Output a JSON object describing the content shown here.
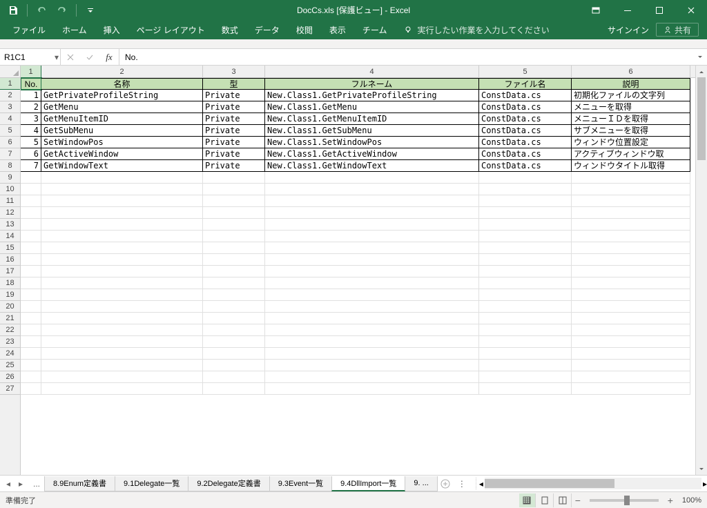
{
  "titlebar": {
    "filename": "DocCs.xls",
    "mode": "[保護ビュー]",
    "app": "Excel"
  },
  "ribbon": {
    "tabs": [
      "ファイル",
      "ホーム",
      "挿入",
      "ページ レイアウト",
      "数式",
      "データ",
      "校閲",
      "表示",
      "チーム"
    ],
    "tell_me": "実行したい作業を入力してください",
    "signin": "サインイン",
    "share": "共有"
  },
  "formula": {
    "namebox": "R1C1",
    "value": "No."
  },
  "columns": {
    "headers": [
      "1",
      "2",
      "3",
      "4",
      "5",
      "6"
    ],
    "widths": [
      30,
      234,
      90,
      310,
      134,
      172
    ]
  },
  "rows": {
    "count": 27
  },
  "table": {
    "headers": [
      "No.",
      "名称",
      "型",
      "フルネーム",
      "ファイル名",
      "説明"
    ],
    "data": [
      {
        "no": "1",
        "name": "GetPrivateProfileString",
        "type": "Private",
        "full": "New.Class1.GetPrivateProfileString",
        "file": "ConstData.cs",
        "desc": "初期化ファイルの文字列"
      },
      {
        "no": "2",
        "name": "GetMenu",
        "type": "Private",
        "full": "New.Class1.GetMenu",
        "file": "ConstData.cs",
        "desc": "メニューを取得"
      },
      {
        "no": "3",
        "name": "GetMenuItemID",
        "type": "Private",
        "full": "New.Class1.GetMenuItemID",
        "file": "ConstData.cs",
        "desc": "メニューＩＤを取得"
      },
      {
        "no": "4",
        "name": "GetSubMenu",
        "type": "Private",
        "full": "New.Class1.GetSubMenu",
        "file": "ConstData.cs",
        "desc": "サブメニューを取得"
      },
      {
        "no": "5",
        "name": "SetWindowPos",
        "type": "Private",
        "full": "New.Class1.SetWindowPos",
        "file": "ConstData.cs",
        "desc": "ウィンドウ位置設定"
      },
      {
        "no": "6",
        "name": "GetActiveWindow",
        "type": "Private",
        "full": "New.Class1.GetActiveWindow",
        "file": "ConstData.cs",
        "desc": "アクティブウィンドウ取"
      },
      {
        "no": "7",
        "name": "GetWindowText",
        "type": "Private",
        "full": "New.Class1.GetWindowText",
        "file": "ConstData.cs",
        "desc": "ウィンドウタイトル取得"
      }
    ]
  },
  "sheet_tabs": {
    "tabs": [
      "8.9Enum定義書",
      "9.1Delegate一覧",
      "9.2Delegate定義書",
      "9.3Event一覧",
      "9.4DllImport一覧",
      "9. ..."
    ],
    "active": 4
  },
  "status": {
    "ready": "準備完了",
    "zoom": "100%"
  }
}
